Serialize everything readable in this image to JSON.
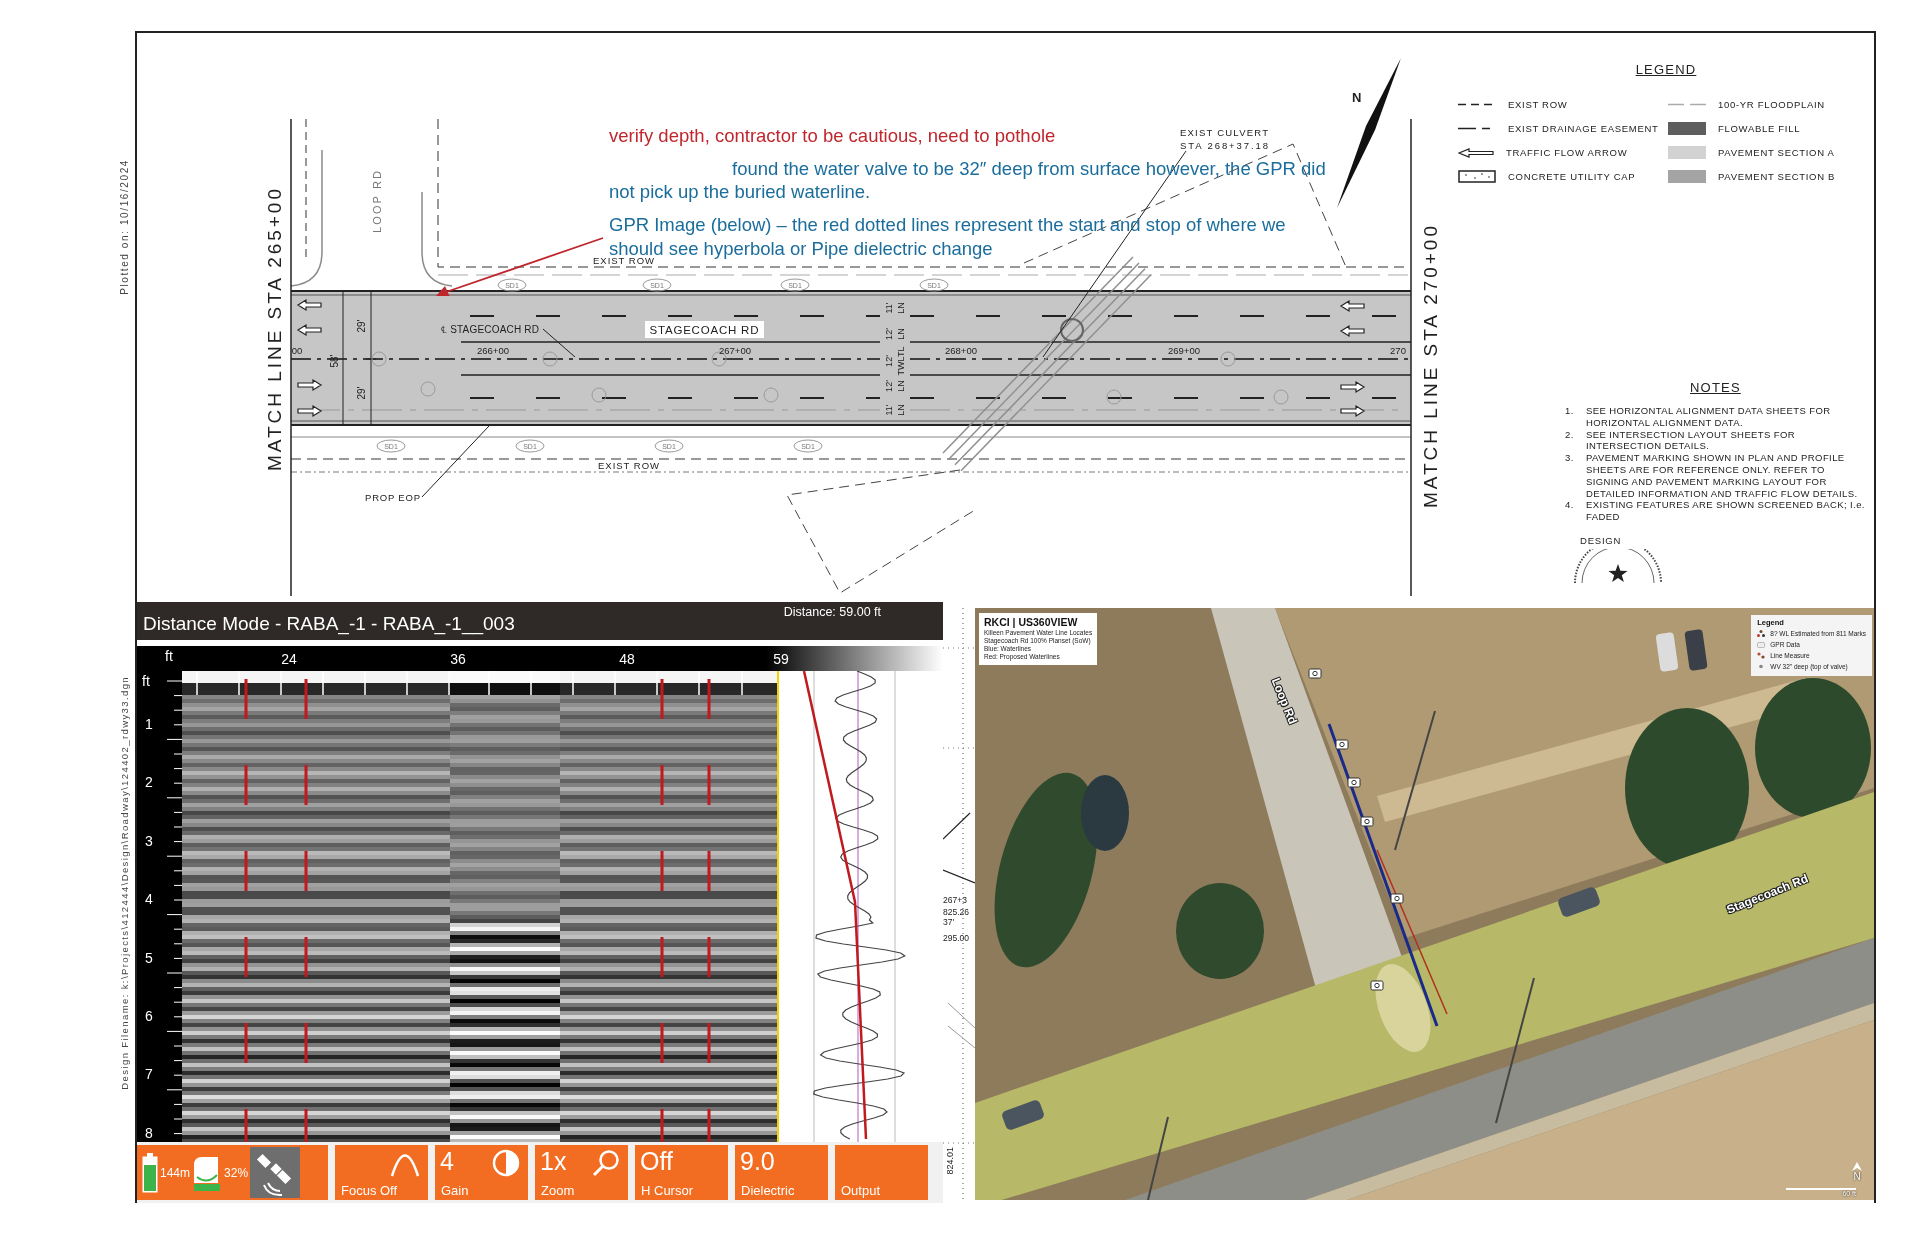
{
  "margin": {
    "plot_date": "Plotted on: 10/16/2024",
    "design_filename": "Design Filename: k:\\Projects\\412444\\Design\\Roadway\\124402_rdwy33.dgn"
  },
  "plan": {
    "match_lines": [
      "MATCH LINE STA 265+00",
      "MATCH LINE STA 270+00"
    ],
    "loop_road": "LOOP RD",
    "row_labels": [
      "EXIST ROW",
      "EXIST ROW"
    ],
    "eop_label": "PROP EOP",
    "culvert_label": [
      "EXIST CULVERT",
      "STA 268+37.18"
    ],
    "centerline_label": "℄ STAGECOACH RD",
    "road_name": "STAGECOACH RD",
    "stations": [
      "00",
      "266+00",
      "267+00",
      "268+00",
      "269+00",
      "270"
    ],
    "half_widths": [
      "29'",
      "29'"
    ],
    "total_width": "58'",
    "lanes": [
      {
        "width": "11'",
        "use": "LN"
      },
      {
        "width": "12'",
        "use": "LN"
      },
      {
        "width": "12'",
        "use": "TWLTL"
      },
      {
        "width": "12'",
        "use": "LN"
      },
      {
        "width": "11'",
        "use": "LN"
      }
    ],
    "drain_tags": [
      "SD1",
      "SD1",
      "SD1",
      "SD1",
      "SD1",
      "SD1",
      "SD1",
      "SD1"
    ],
    "north": "N",
    "annotations": [
      {
        "text": "verify depth, contractor to be cautious, need to pothole",
        "color": "#c0272d"
      },
      {
        "text": "found the water valve to be 32″ deep from surface however, the GPR did not pick up the buried waterline.",
        "color": "#1b6d9c"
      },
      {
        "text": "GPR Image (below) – the red dotted lines represent the start and stop of where we should see hyperbola or Pipe dielectric change",
        "color": "#1b6d9c"
      }
    ]
  },
  "legend": {
    "title": "LEGEND",
    "items": [
      {
        "kind": "short-dash",
        "label": "EXIST ROW"
      },
      {
        "kind": "faint-dash",
        "label": "100-YR FLOODPLAIN"
      },
      {
        "kind": "long-dash",
        "label": "EXIST DRAINAGE EASEMENT"
      },
      {
        "kind": "swatch",
        "color": "#5e5e5e",
        "label": "FLOWABLE FILL"
      },
      {
        "kind": "arrow",
        "label": "TRAFFIC FLOW ARROW"
      },
      {
        "kind": "swatch",
        "color": "#d2d2d2",
        "label": "PAVEMENT SECTION A"
      },
      {
        "kind": "cap",
        "label": "CONCRETE UTILITY CAP"
      },
      {
        "kind": "swatch",
        "color": "#a4a4a4",
        "label": "PAVEMENT SECTION B"
      }
    ]
  },
  "notes": {
    "title": "NOTES",
    "items": [
      {
        "number": "1.",
        "text": "SEE HORIZONTAL ALIGNMENT DATA SHEETS FOR HORIZONTAL ALIGNMENT DATA."
      },
      {
        "number": "2.",
        "text": "SEE INTERSECTION LAYOUT SHEETS FOR INTERSECTION DETAILS."
      },
      {
        "number": "3.",
        "text": "PAVEMENT MARKING SHOWN IN PLAN AND PROFILE SHEETS ARE FOR REFERENCE ONLY. REFER TO SIGNING AND PAVEMENT MARKING LAYOUT FOR DETAILED INFORMATION AND TRAFFIC FLOW DETAILS."
      },
      {
        "number": "4.",
        "text": "EXISTING FEATURES ARE SHOWN SCREENED BACK; I.e. FADED"
      }
    ]
  },
  "design": {
    "label": "DESIGN"
  },
  "gpr": {
    "title": "Distance Mode - RABA_-1 - RABA_-1__003",
    "distance": "Distance: 59.00 ft",
    "x_unit": "ft",
    "x_ticks": [
      "24",
      "36",
      "48",
      "59"
    ],
    "depth_unit": "ft",
    "depth_ticks": [
      "1",
      "2",
      "3",
      "4",
      "5",
      "6",
      "7",
      "8"
    ],
    "status": {
      "battery": "144m",
      "storage": "32%"
    },
    "buttons": [
      {
        "kind": "focus",
        "label": "Focus Off"
      },
      {
        "kind": "gain",
        "value": "4",
        "label": "Gain"
      },
      {
        "kind": "zoom",
        "value": "1x",
        "label": "Zoom"
      },
      {
        "kind": "text",
        "value": "Off",
        "label": "H Cursor"
      },
      {
        "kind": "text",
        "value": "9.0",
        "label": "Dielectric"
      },
      {
        "kind": "text",
        "label": "Output"
      }
    ]
  },
  "plan_strip": {
    "labels": [
      "267+3",
      "825.26",
      "37'",
      "295.00"
    ],
    "vertical_label": "824.01"
  },
  "aerial": {
    "title": "RKCI | US360VIEW",
    "lines": [
      "Killeen Pavement Water Line Locates",
      "Stagecoach Rd 100% Planset (SoW)",
      "Blue: Waterlines",
      "Red: Proposed Waterlines"
    ],
    "legend": {
      "title": "Legend",
      "items": [
        {
          "kind": "cluster",
          "label": "8? WL Estimated from 811 Marks"
        },
        {
          "kind": "camera",
          "label": "GPR Data"
        },
        {
          "kind": "measure",
          "label": "Line Measure"
        },
        {
          "kind": "dot",
          "label": "WV 32\" deep (top of valve)"
        }
      ]
    },
    "road_labels": [
      "Loop Rd",
      "Stagecoach Rd"
    ],
    "scale": "60 ft",
    "north": "N"
  }
}
